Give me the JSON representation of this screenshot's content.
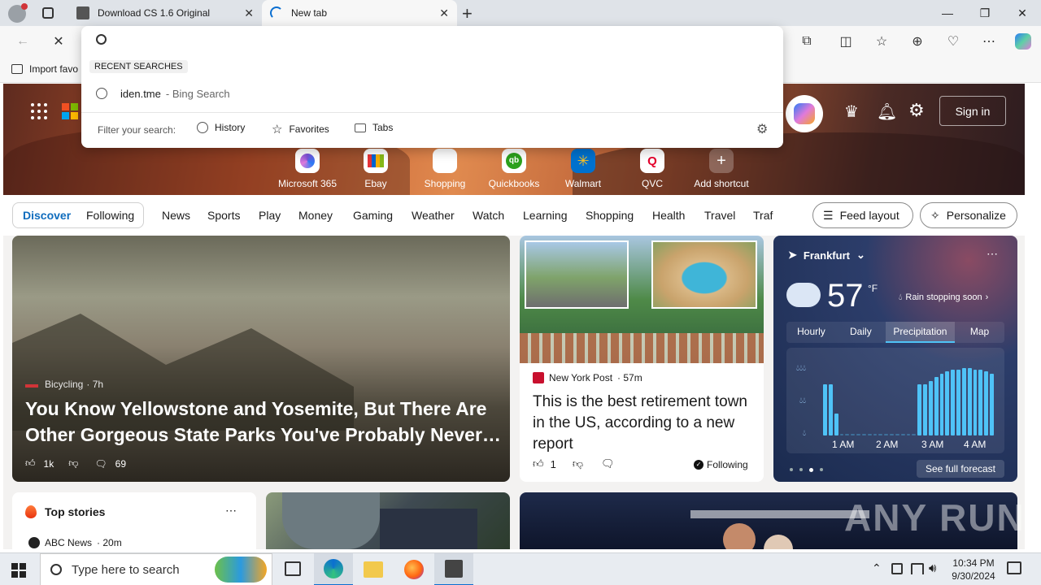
{
  "tabs": [
    {
      "title": "Download CS 1.6 Original",
      "active": false
    },
    {
      "title": "New tab",
      "active": true
    }
  ],
  "favorites_bar": {
    "import_label": "Import favo"
  },
  "omnibox": {
    "query": "",
    "recent_header": "RECENT SEARCHES",
    "recent_items": [
      {
        "term": "iden.tme",
        "source": "- Bing Search"
      }
    ],
    "filter_label": "Filter your search:",
    "filters": [
      "History",
      "Favorites",
      "Tabs"
    ]
  },
  "hero": {
    "sign_in": "Sign in",
    "shortcuts": [
      {
        "label": "Microsoft 365",
        "icon": "microsoft365-icon",
        "color": "#7b4fd6"
      },
      {
        "label": "Ebay",
        "icon": "ebay-icon",
        "color": "#e53238"
      },
      {
        "label": "Shopping",
        "icon": "shopping-tag-icon",
        "color": "#333333"
      },
      {
        "label": "Quickbooks",
        "icon": "quickbooks-icon",
        "color": "#2ca01c"
      },
      {
        "label": "Walmart",
        "icon": "walmart-icon",
        "color": "#0071ce"
      },
      {
        "label": "QVC",
        "icon": "qvc-icon",
        "color": "#e4002b"
      },
      {
        "label": "Add shortcut",
        "icon": "plus-icon",
        "color": "#ffffff"
      }
    ]
  },
  "nav": {
    "tabs": [
      "Discover",
      "Following"
    ],
    "items": [
      "News",
      "Sports",
      "Play",
      "Money",
      "Gaming",
      "Weather",
      "Watch",
      "Learning",
      "Shopping",
      "Health",
      "Travel",
      "Traf"
    ],
    "feed_layout": "Feed layout",
    "personalize": "Personalize"
  },
  "main_card": {
    "source": "Bicycling",
    "time": "· 7h",
    "headline": "You Know Yellowstone and Yosemite, But There Are Other Gorgeous State Parks You've Probably Never…",
    "likes": "1k",
    "comments": "69"
  },
  "news_card": {
    "source": "New York Post",
    "time": "· 57m",
    "headline": "This is the best retirement town in the US, according to a new report",
    "likes": "1",
    "following": "Following"
  },
  "weather": {
    "city": "Frankfurt",
    "temp": "57",
    "unit": "°F",
    "status": "Rain stopping soon",
    "tabs": [
      "Hourly",
      "Daily",
      "Precipitation",
      "Map"
    ],
    "times": [
      "1 AM",
      "2 AM",
      "3 AM",
      "4 AM"
    ],
    "see_full": "See full forecast",
    "precip_levels": [
      0.7,
      0.7,
      0.3,
      0,
      0,
      0,
      0,
      0,
      0,
      0,
      0,
      0,
      0,
      0,
      0,
      0,
      0,
      0.7,
      0.7,
      0.75,
      0.8,
      0.85,
      0.88,
      0.9,
      0.9,
      0.92,
      0.92,
      0.9,
      0.9,
      0.88,
      0.85
    ]
  },
  "top_stories": {
    "title": "Top stories",
    "source": "ABC News",
    "time": "· 20m"
  },
  "taskbar": {
    "search_placeholder": "Type here to search",
    "time": "10:34 PM",
    "date": "9/30/2024"
  },
  "watermark": "ANY RUN"
}
